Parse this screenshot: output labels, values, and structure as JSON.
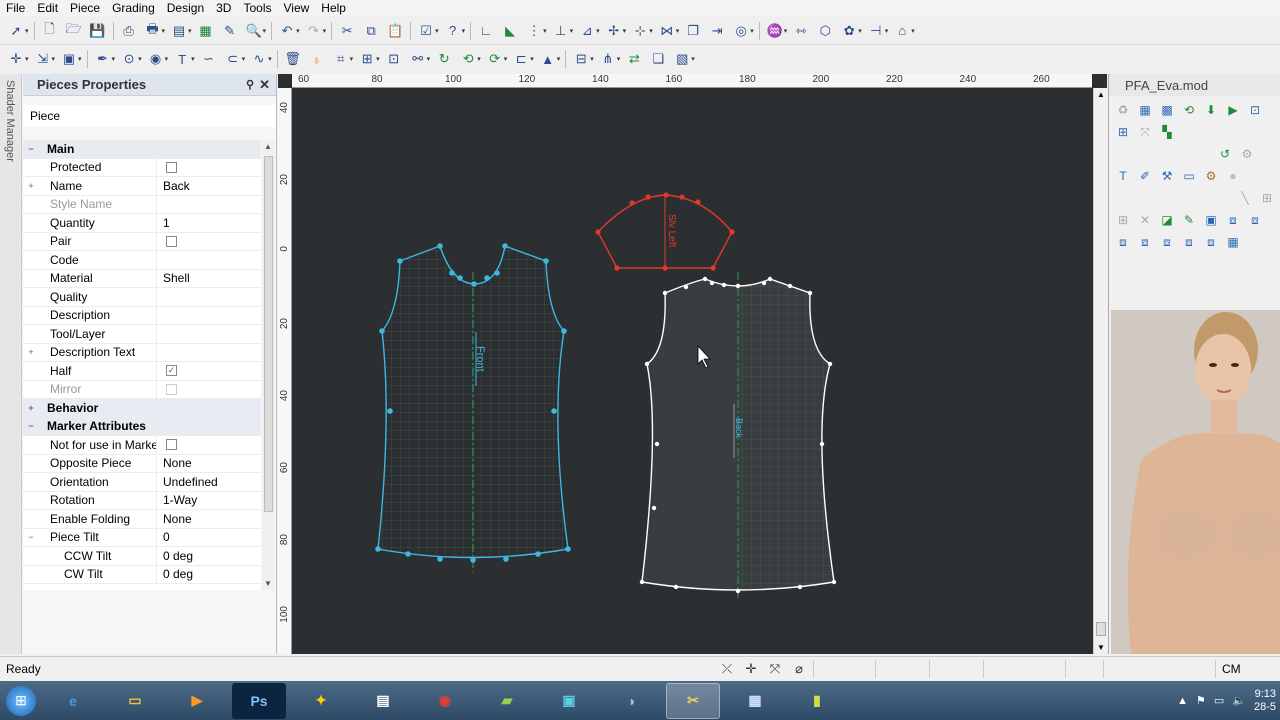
{
  "menu": [
    "File",
    "Edit",
    "Piece",
    "Grading",
    "Design",
    "3D",
    "Tools",
    "View",
    "Help"
  ],
  "shader_tab": "Shader Manager",
  "properties": {
    "title": "Pieces Properties",
    "pin_icon": "pin-icon",
    "close_icon": "close-icon",
    "subtitle": "Piece",
    "rows": [
      {
        "type": "group",
        "name": "Main",
        "expand": "−"
      },
      {
        "name": "Protected",
        "check": false
      },
      {
        "name": "Name",
        "value": "Back",
        "expand": "+"
      },
      {
        "name": "Style Name",
        "value": "",
        "dim": true
      },
      {
        "name": "Quantity",
        "value": "1"
      },
      {
        "name": "Pair",
        "check": false
      },
      {
        "name": "Code",
        "value": ""
      },
      {
        "name": "Material",
        "value": "Shell"
      },
      {
        "name": "Quality",
        "value": ""
      },
      {
        "name": "Description",
        "value": ""
      },
      {
        "name": "Tool/Layer",
        "value": ""
      },
      {
        "name": "Description Text",
        "value": "",
        "expand": "+"
      },
      {
        "name": "Half",
        "check": true
      },
      {
        "name": "Mirror",
        "check": false,
        "dim": true,
        "disabled": true
      },
      {
        "type": "group",
        "name": "Behavior",
        "expand": "+"
      },
      {
        "type": "group",
        "name": "Marker Attributes",
        "expand": "−"
      },
      {
        "name": "Not for use in Marke",
        "check": false
      },
      {
        "name": "Opposite Piece",
        "value": "None"
      },
      {
        "name": "Orientation",
        "value": "Undefined"
      },
      {
        "name": "Rotation",
        "value": "1-Way"
      },
      {
        "name": "Enable Folding",
        "value": "None"
      },
      {
        "name": "Piece Tilt",
        "value": "0",
        "expand": "−"
      },
      {
        "name": "CCW Tilt",
        "value": "0 deg",
        "sub": true
      },
      {
        "name": "CW Tilt",
        "value": "0 deg",
        "sub": true
      }
    ]
  },
  "ruler": {
    "top": [
      "60",
      "80",
      "100",
      "120",
      "140",
      "160",
      "180",
      "200",
      "220",
      "240",
      "260"
    ],
    "left": [
      "40",
      "20",
      "0",
      "20",
      "40",
      "60",
      "80",
      "100"
    ]
  },
  "pieces": {
    "front_label": "Front",
    "sleeve_label": "Slv Left",
    "back_label": "Back"
  },
  "right_panel": {
    "title": "PFA_Eva.mod"
  },
  "status": {
    "ready": "Ready",
    "unit": "CM"
  },
  "clock": {
    "time": "9:13",
    "date": "28-5"
  },
  "colors": {
    "front": "#3fb6e0",
    "sleeve": "#e0392b",
    "back": "#ffffff",
    "grainline": "#2e9a55",
    "canvas_bg": "#2c2f31"
  }
}
